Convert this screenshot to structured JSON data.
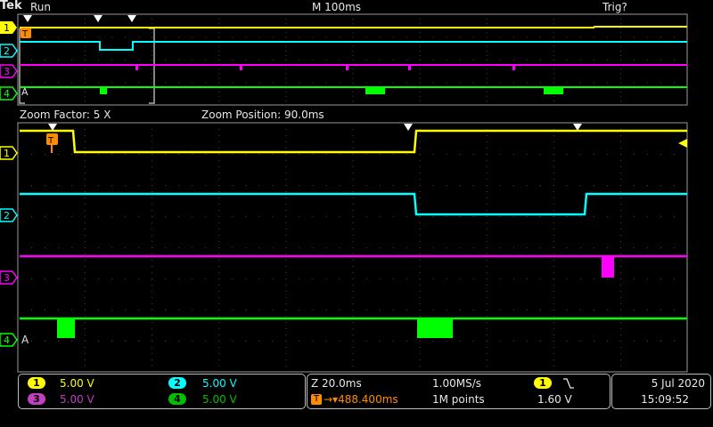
{
  "header": {
    "logo": "Tek",
    "run_state": "Run",
    "timebase": "M 100ms",
    "trigger_status": "Trig?"
  },
  "zoom": {
    "factor_label": "Zoom Factor: 5 X",
    "position_label": "Zoom Position: 90.0ms"
  },
  "channels": [
    {
      "id": "1",
      "color": "#ffff00",
      "scale": "5.00 V"
    },
    {
      "id": "2",
      "color": "#00ffff",
      "scale": "5.00 V"
    },
    {
      "id": "3",
      "color": "#ff00ff",
      "scale": "5.00 V"
    },
    {
      "id": "4",
      "color": "#00ff00",
      "scale": "5.00 V"
    }
  ],
  "labels": {
    "T": "T",
    "A": "A"
  },
  "acquisition": {
    "zoom_timebase": "Z 20.0ms",
    "sample_rate": "1.00MS/s",
    "trigger_position": "→▾488.400ms",
    "record_length": "1M points"
  },
  "trigger": {
    "source": "1",
    "slope_icon": "falling-edge-icon",
    "level": "1.60 V"
  },
  "clock": {
    "date": "5 Jul  2020",
    "time": "15:09:52"
  }
}
